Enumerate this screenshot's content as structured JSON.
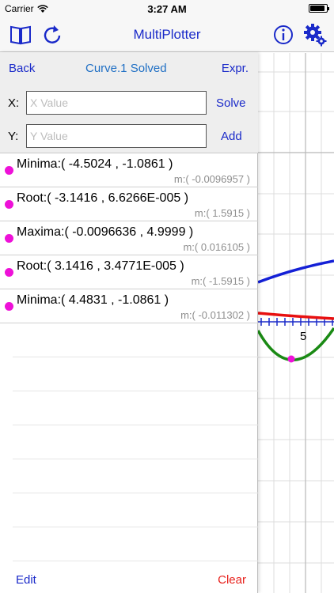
{
  "status_bar": {
    "carrier": "Carrier",
    "time": "3:27 AM",
    "battery_level": 0.9
  },
  "nav": {
    "title": "MultiPlotter",
    "left_icons": [
      "book-icon",
      "refresh-icon"
    ],
    "right_icons": [
      "info-icon",
      "gear-icon"
    ],
    "accent_color": "#1a2ac9"
  },
  "panel": {
    "back_label": "Back",
    "title": "Curve.1 Solved",
    "expr_label": "Expr.",
    "x_label": "X:",
    "x_placeholder": "X Value",
    "x_value": "",
    "y_label": "Y:",
    "y_placeholder": "Y Value",
    "y_value": "",
    "solve_label": "Solve",
    "add_label": "Add",
    "edit_label": "Edit",
    "clear_label": "Clear"
  },
  "results": [
    {
      "main": "Minima:( -4.5024 , -1.0861 )",
      "sub": "m:( -0.0096957 )"
    },
    {
      "main": "Root:( -3.1416 , 6.6266E-005 )",
      "sub": "m:( 1.5915 )"
    },
    {
      "main": "Maxima:( -0.0096636 , 4.9999 )",
      "sub": "m:( 0.016105 )"
    },
    {
      "main": "Root:( 3.1416 , 3.4771E-005 )",
      "sub": "m:( -1.5915 )"
    },
    {
      "main": "Minima:( 4.4831 , -1.0861 )",
      "sub": "m:( -0.011302 )"
    }
  ],
  "graph": {
    "axis_tick_label": "5",
    "curve_colors": {
      "blue": "#1420d6",
      "red": "#e81010",
      "green": "#1a8a14"
    },
    "point_color": "#ee11d8"
  }
}
